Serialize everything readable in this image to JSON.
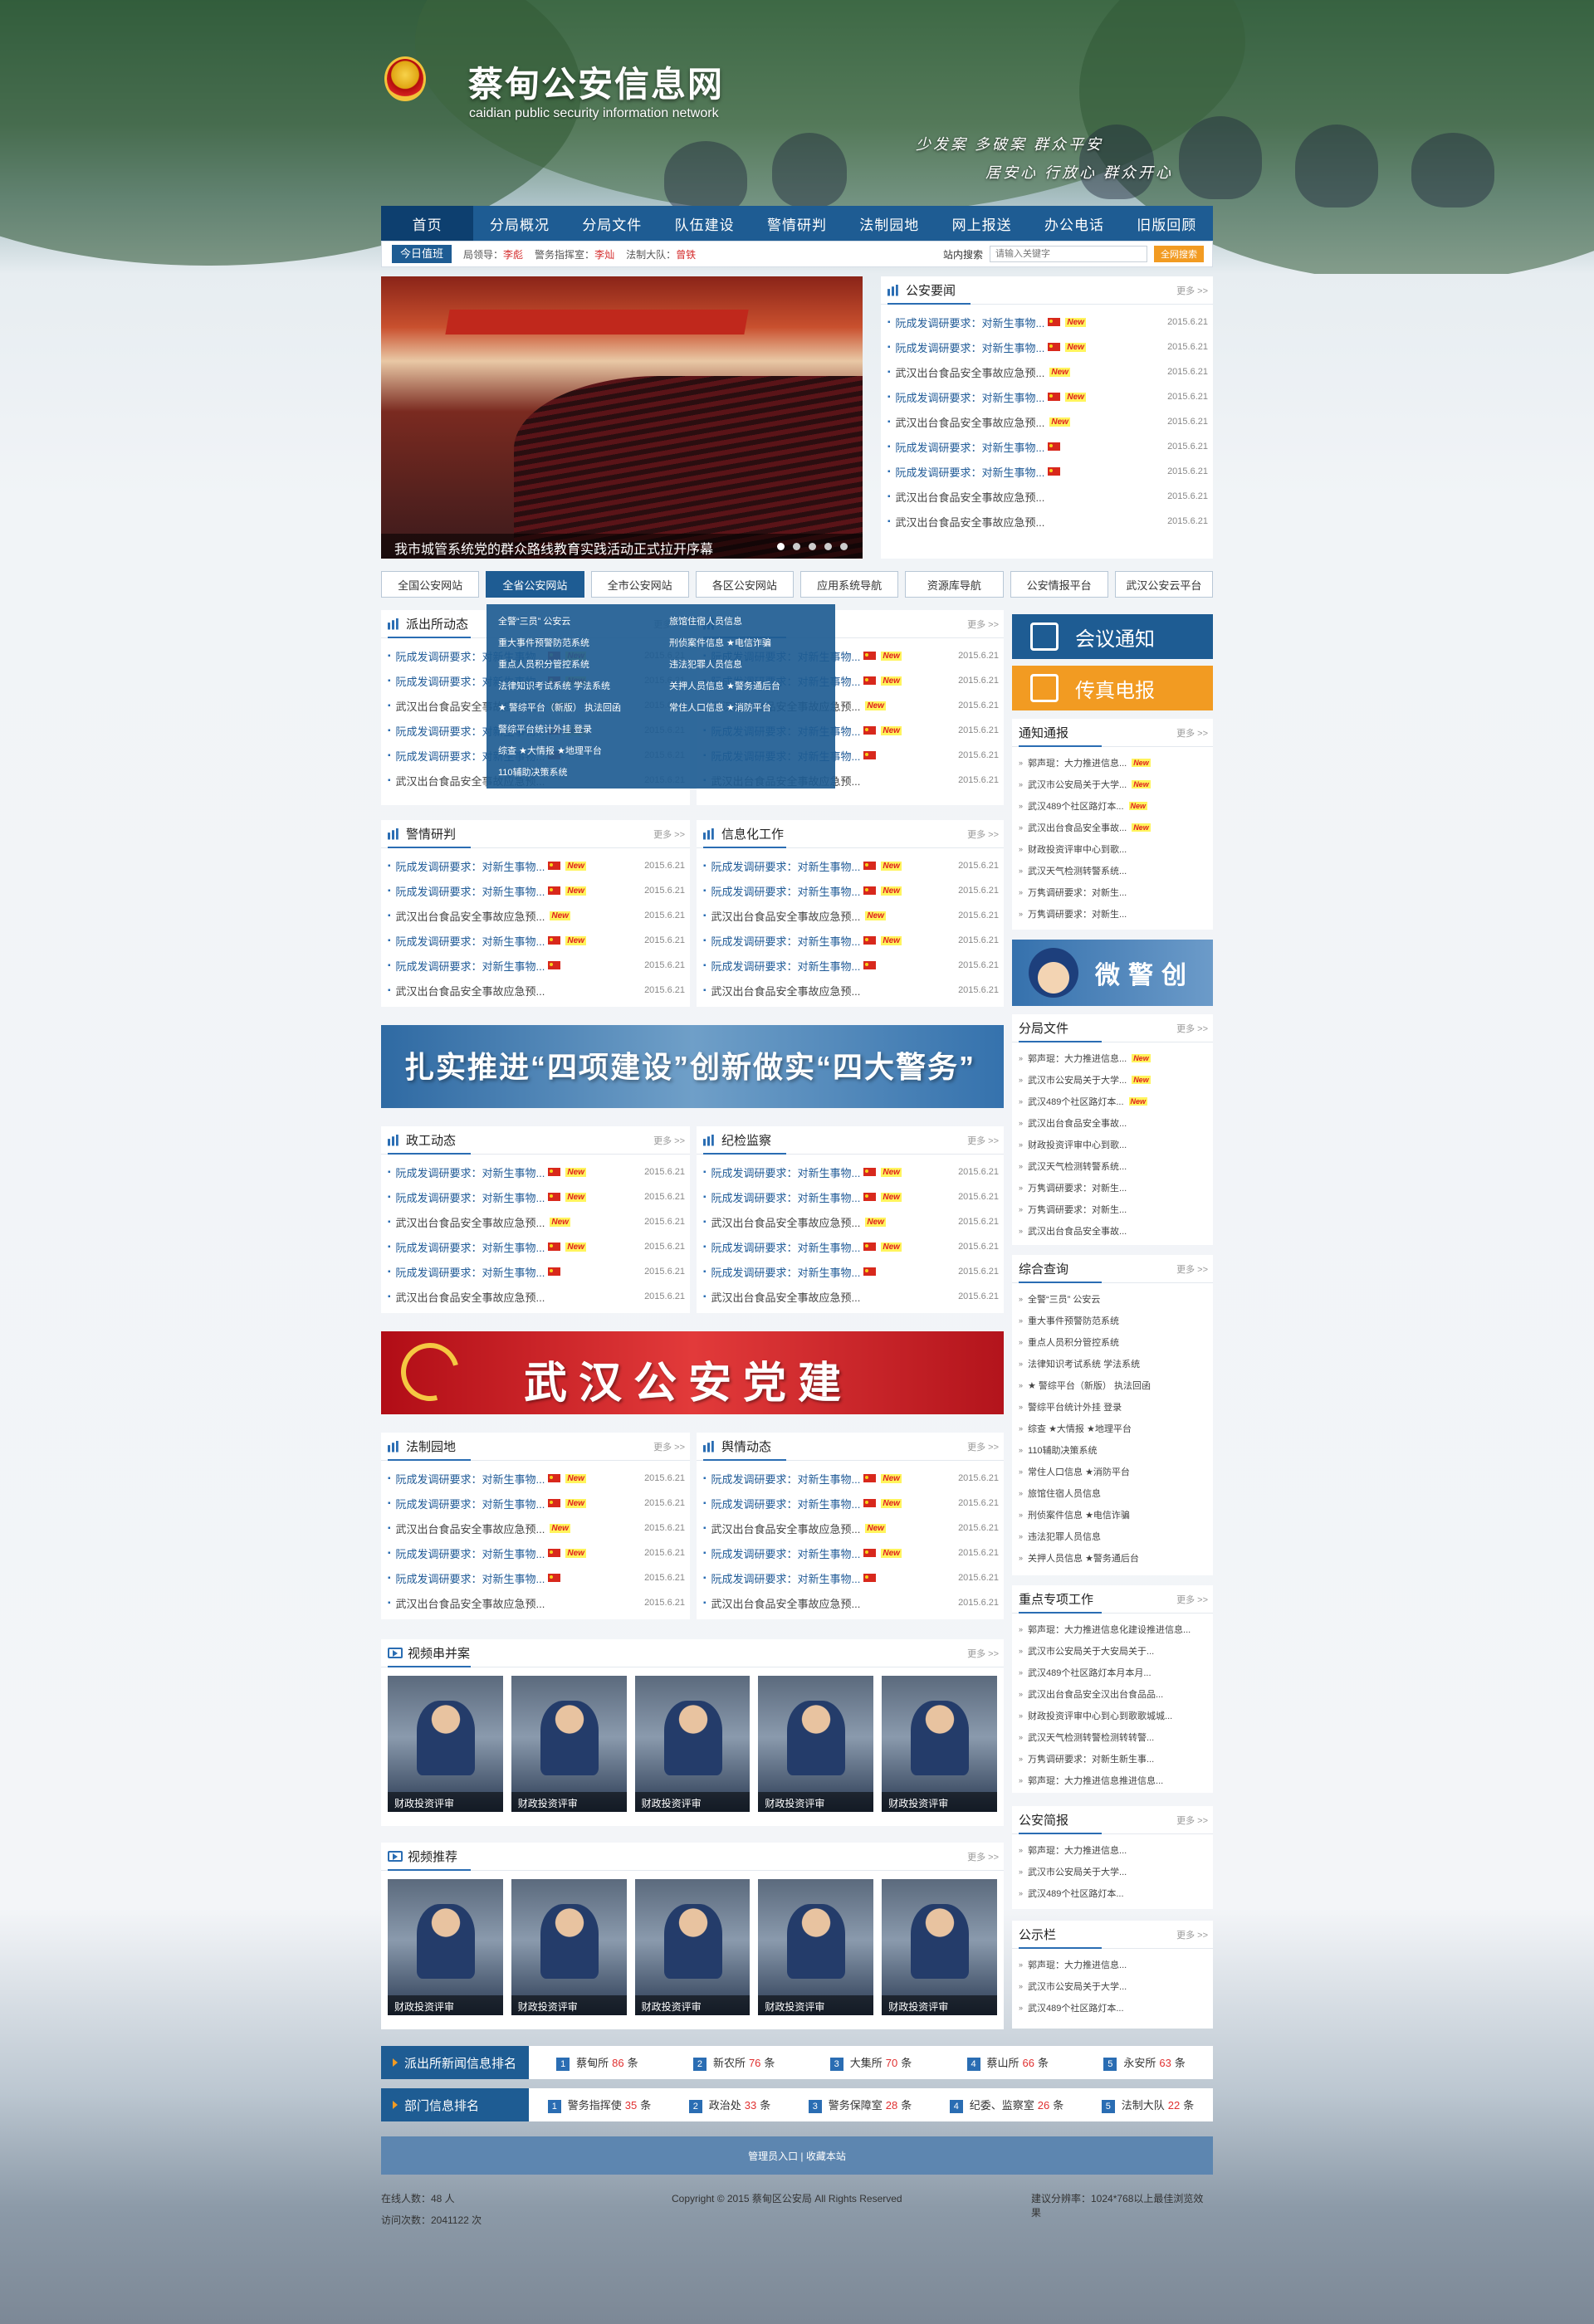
{
  "site": {
    "title": "蔡甸公安信息网",
    "subtitle": "caidian public security information network",
    "slogan1": "少发案  多破案  群众平安",
    "slogan2": "居安心  行放心  群众开心"
  },
  "nav": [
    "首页",
    "分局概况",
    "分局文件",
    "队伍建设",
    "警情研判",
    "法制园地",
    "网上报送",
    "办公电话",
    "旧版回顾"
  ],
  "subbar": {
    "duty": "今日值班",
    "leader_label": "局领导：",
    "leader": "李彪",
    "command_label": "警务指挥室：",
    "command": "李灿",
    "legal_label": "法制大队：",
    "legal": "曾铁",
    "search_label": "站内搜索",
    "search_placeholder": "请输入关键字",
    "search_btn": "全网搜索"
  },
  "slide": {
    "caption": "我市城管系统党的群众路线教育实践活动正式拉开序幕"
  },
  "news_panel": {
    "title": "公安要闻",
    "more": "更多 >>",
    "items": [
      {
        "t": "阮成发调研要求：对新生事物...",
        "d": "2015.6.21",
        "flag": true,
        "new": true
      },
      {
        "t": "阮成发调研要求：对新生事物...",
        "d": "2015.6.21",
        "flag": true,
        "new": true
      },
      {
        "t": "武汉出台食品安全事故应急预...",
        "d": "2015.6.21",
        "flag": false,
        "new": true
      },
      {
        "t": "阮成发调研要求：对新生事物...",
        "d": "2015.6.21",
        "flag": true,
        "new": true
      },
      {
        "t": "武汉出台食品安全事故应急预...",
        "d": "2015.6.21",
        "flag": false,
        "new": true
      },
      {
        "t": "阮成发调研要求：对新生事物...",
        "d": "2015.6.21",
        "flag": true,
        "new": false
      },
      {
        "t": "阮成发调研要求：对新生事物...",
        "d": "2015.6.21",
        "flag": true,
        "new": false
      },
      {
        "t": "武汉出台食品安全事故应急预...",
        "d": "2015.6.21",
        "flag": false,
        "new": false
      },
      {
        "t": "武汉出台食品安全事故应急预...",
        "d": "2015.6.21",
        "flag": false,
        "new": false
      }
    ]
  },
  "link_tabs": [
    "全国公安网站",
    "全省公安网站",
    "全市公安网站",
    "各区公安网站",
    "应用系统导航",
    "资源库导航",
    "公安情报平台",
    "武汉公安云平台"
  ],
  "dropdown": [
    "全警“三员”  公安云",
    "旅馆住宿人员信息",
    "重大事件预警防范系统",
    "刑侦案件信息  ★电信诈骗",
    "重点人员积分管控系统",
    "违法犯罪人员信息",
    "法律知识考试系统  学法系统",
    "关押人员信息  ★警务通后台",
    "★ 警综平台（新版） 执法回函",
    "常住人口信息  ★消防平台",
    "警综平台统计外挂  登录",
    "",
    "综查  ★大情报  ★地理平台",
    "",
    "110辅助决策系统",
    ""
  ],
  "generic_items": [
    {
      "t": "阮成发调研要求：对新生事物...",
      "d": "2015.6.21",
      "flag": true,
      "new": true
    },
    {
      "t": "阮成发调研要求：对新生事物...",
      "d": "2015.6.21",
      "flag": true,
      "new": true
    },
    {
      "t": "武汉出台食品安全事故应急预...",
      "d": "2015.6.21",
      "flag": false,
      "new": true
    },
    {
      "t": "阮成发调研要求：对新生事物...",
      "d": "2015.6.21",
      "flag": true,
      "new": true
    },
    {
      "t": "阮成发调研要求：对新生事物...",
      "d": "2015.6.21",
      "flag": true,
      "new": false
    },
    {
      "t": "武汉出台食品安全事故应急预...",
      "d": "2015.6.21",
      "flag": false,
      "new": false
    }
  ],
  "section_titles": {
    "pcs": "派出所动态",
    "jqyp": "警情研判",
    "xxh": "信息化工作",
    "zgdt": "政工动态",
    "jjjc": "纪检监察",
    "fzyd": "法制园地",
    "yqdt": "舆情动态"
  },
  "more": "更多 >>",
  "banner1": "扎实推进“四项建设”创新做实“四大警务”",
  "banner2": "武汉公安党建",
  "right": {
    "meeting": "会议通知",
    "fax": "传真电报",
    "police_banner": "微警创",
    "tzbb": {
      "title": "通知通报",
      "items": [
        "郭声琨：大力推进信息...",
        "武汉市公安局关于大学...",
        "武汉489个社区路灯本...",
        "武汉出台食品安全事故...",
        "财政投资评审中心到歌...",
        "武汉天气检测转警系统...",
        "万隽调研要求：对新生...",
        "万隽调研要求：对新生..."
      ],
      "new": [
        true,
        true,
        true,
        true,
        false,
        false,
        false,
        false
      ]
    },
    "fjwj": {
      "title": "分局文件",
      "items": [
        "郭声琨：大力推进信息...",
        "武汉市公安局关于大学...",
        "武汉489个社区路灯本...",
        "武汉出台食品安全事故...",
        "财政投资评审中心到歌...",
        "武汉天气检测转警系统...",
        "万隽调研要求：对新生...",
        "万隽调研要求：对新生...",
        "武汉出台食品安全事故..."
      ],
      "new": [
        true,
        true,
        true,
        false,
        false,
        false,
        false,
        false,
        false
      ]
    },
    "zhcx": {
      "title": "综合查询",
      "items": [
        "全警“三员”  公安云",
        "重大事件预警防范系统",
        "重点人员积分管控系统",
        "法律知识考试系统  学法系统",
        "★ 警综平台（新版） 执法回函",
        "警综平台统计外挂  登录",
        "综查  ★大情报  ★地理平台",
        "110辅助决策系统",
        "常住人口信息  ★消防平台",
        "旅馆住宿人员信息",
        "刑侦案件信息  ★电信诈骗",
        "违法犯罪人员信息",
        "关押人员信息  ★警务通后台"
      ]
    },
    "zdzx": {
      "title": "重点专项工作",
      "items": [
        "郭声琨：大力推进信息化建设推进信息...",
        "武汉市公安局关于大安局关于...",
        "武汉489个社区路灯本月本月...",
        "武汉出台食品安全汉出台食品品...",
        "财政投资评审中心到心到歌歌城城...",
        "武汉天气检测转警检测转转警...",
        "万隽调研要求：对新生新生事...",
        "郭声琨：大力推进信息推进信息..."
      ]
    },
    "gajb": {
      "title": "公安简报",
      "items": [
        "郭声琨：大力推进信息...",
        "武汉市公安局关于大学...",
        "武汉489个社区路灯本..."
      ]
    },
    "gsl": {
      "title": "公示栏",
      "items": [
        "郭声琨：大力推进信息...",
        "武汉市公安局关于大学...",
        "武汉489个社区路灯本..."
      ]
    }
  },
  "video1": {
    "title": "视频串并案",
    "cap": "财政投资评审"
  },
  "video2": {
    "title": "视频推荐",
    "cap": "财政投资评审"
  },
  "rank1": {
    "label": "派出所新闻信息排名",
    "unit": "条",
    "items": [
      {
        "n": "1",
        "name": "蔡甸所",
        "c": "86"
      },
      {
        "n": "2",
        "name": "新农所",
        "c": "76"
      },
      {
        "n": "3",
        "name": "大集所",
        "c": "70"
      },
      {
        "n": "4",
        "name": "蔡山所",
        "c": "66"
      },
      {
        "n": "5",
        "name": "永安所",
        "c": "63"
      }
    ]
  },
  "rank2": {
    "label": "部门信息排名",
    "unit": "条",
    "items": [
      {
        "n": "1",
        "name": "警务指挥使",
        "c": "35"
      },
      {
        "n": "2",
        "name": "政治处",
        "c": "33"
      },
      {
        "n": "3",
        "name": "警务保障室",
        "c": "28"
      },
      {
        "n": "4",
        "name": "纪委、监察室",
        "c": "26"
      },
      {
        "n": "5",
        "name": "法制大队",
        "c": "22"
      }
    ]
  },
  "footer": {
    "admin": "管理员入口  |  收藏本站",
    "online": "在线人数：48 人",
    "visits": "访问次数：2041122 次",
    "copyright": "Copyright © 2015  蔡甸区公安局  All Rights Reserved",
    "resolution": "建议分辨率：1024*768以上最佳浏览效果"
  }
}
